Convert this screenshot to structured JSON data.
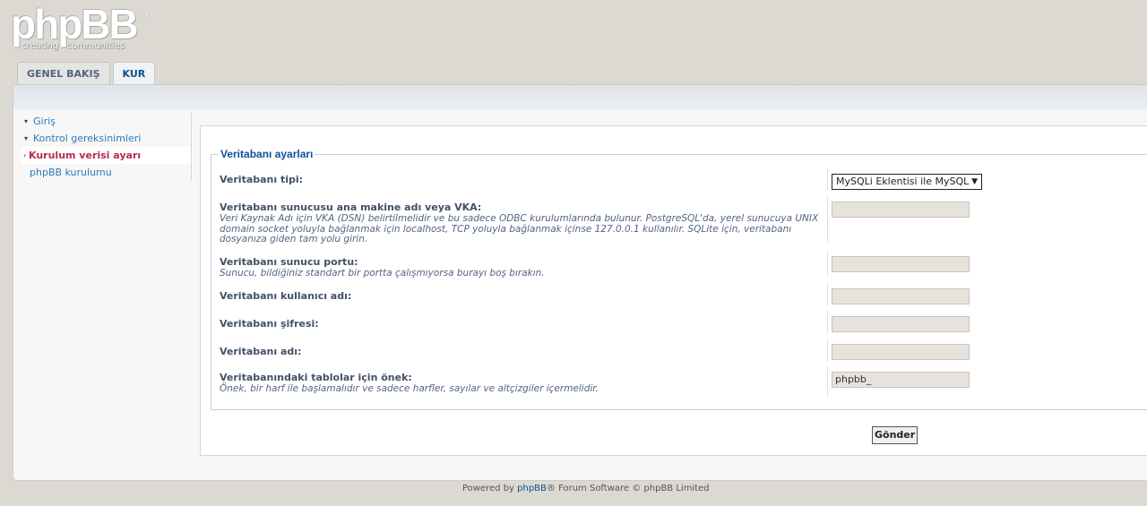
{
  "logo": {
    "main": "phpBB",
    "reg": "®",
    "tagline": "creating communities"
  },
  "tabs": [
    {
      "label": "GENEL BAKIŞ",
      "active": false
    },
    {
      "label": "KUR",
      "active": true
    }
  ],
  "menu": [
    {
      "label": "Giriş",
      "state": "done"
    },
    {
      "label": "Kontrol gereksinimleri",
      "state": "done"
    },
    {
      "label": "Kurulum verisi ayarı",
      "state": "active"
    },
    {
      "label": "phpBB kurulumu",
      "state": "pending"
    }
  ],
  "form": {
    "legend": "Veritabanı ayarları",
    "db_type": {
      "label": "Veritabanı tipi:",
      "selected": "MySQLi Eklentisi ile MySQL"
    },
    "db_host": {
      "label": "Veritabanı sunucusu ana makine adı veya VKA:",
      "explain": "Veri Kaynak Adı için VKA (DSN) belirtilmelidir ve bu sadece ODBC kurulumlarında bulunur. PostgreSQL'da, yerel sunucuya UNIX domain socket yoluyla bağlanmak için localhost, TCP yoluyla bağlanmak içinse 127.0.0.1 kullanılır. SQLite için, veritabanı dosyanıza giden tam yolu girin.",
      "value": ""
    },
    "db_port": {
      "label": "Veritabanı sunucu portu:",
      "explain": "Sunucu, bildiğiniz standart bir portta çalışmıyorsa burayı boş bırakın.",
      "value": ""
    },
    "db_user": {
      "label": "Veritabanı kullanıcı adı:",
      "value": ""
    },
    "db_pass": {
      "label": "Veritabanı şifresi:",
      "value": ""
    },
    "db_name": {
      "label": "Veritabanı adı:",
      "value": ""
    },
    "table_prefix": {
      "label": "Veritabanındaki tablolar için önek:",
      "explain": "Önek, bir harf ile başlamalıdır ve sadece harfler, sayılar ve altçizgiler içermelidir.",
      "value": "phpbb_"
    },
    "submit_label": "Gönder"
  },
  "footer": {
    "prefix": "Powered by ",
    "link": "phpBB",
    "suffix": "® Forum Software © phpBB Limited"
  }
}
